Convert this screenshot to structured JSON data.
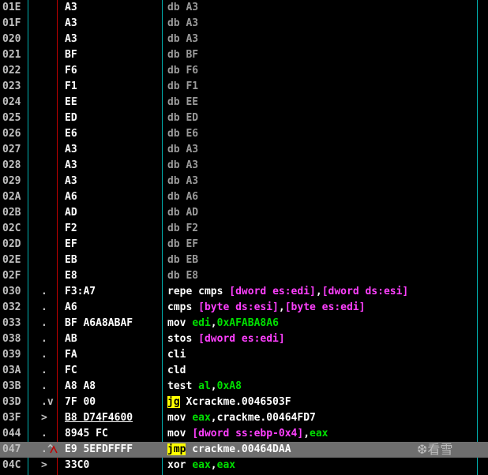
{
  "colors": {
    "background": "#000000",
    "address": "#c0c0c0",
    "hex": "#ffffff",
    "db_text": "#9a9a9a",
    "instruction": "#ffffff",
    "memory_operand": "#ff40ff",
    "register_and_immediate": "#00e000",
    "jump_highlight": "#ffff00",
    "selected_row": "#6e6e6e",
    "gutter_line": "#00b0b0",
    "separator_line": "#c00000"
  },
  "watermark": {
    "icon": "snowflake-icon",
    "glyph": "❆",
    "text": "看雪"
  },
  "rows": [
    {
      "addr": "01E",
      "flag": "",
      "hex": "A3",
      "dis": [
        {
          "t": "db A3",
          "c": "db"
        }
      ]
    },
    {
      "addr": "01F",
      "flag": "",
      "hex": "A3",
      "dis": [
        {
          "t": "db A3",
          "c": "db"
        }
      ]
    },
    {
      "addr": "020",
      "flag": "",
      "hex": "A3",
      "dis": [
        {
          "t": "db A3",
          "c": "db"
        }
      ]
    },
    {
      "addr": "021",
      "flag": "",
      "hex": "BF",
      "dis": [
        {
          "t": "db BF",
          "c": "db"
        }
      ]
    },
    {
      "addr": "022",
      "flag": "",
      "hex": "F6",
      "dis": [
        {
          "t": "db F6",
          "c": "db"
        }
      ]
    },
    {
      "addr": "023",
      "flag": "",
      "hex": "F1",
      "dis": [
        {
          "t": "db F1",
          "c": "db"
        }
      ]
    },
    {
      "addr": "024",
      "flag": "",
      "hex": "EE",
      "dis": [
        {
          "t": "db EE",
          "c": "db"
        }
      ]
    },
    {
      "addr": "025",
      "flag": "",
      "hex": "ED",
      "dis": [
        {
          "t": "db ED",
          "c": "db"
        }
      ]
    },
    {
      "addr": "026",
      "flag": "",
      "hex": "E6",
      "dis": [
        {
          "t": "db E6",
          "c": "db"
        }
      ]
    },
    {
      "addr": "027",
      "flag": "",
      "hex": "A3",
      "dis": [
        {
          "t": "db A3",
          "c": "db"
        }
      ]
    },
    {
      "addr": "028",
      "flag": "",
      "hex": "A3",
      "dis": [
        {
          "t": "db A3",
          "c": "db"
        }
      ]
    },
    {
      "addr": "029",
      "flag": "",
      "hex": "A3",
      "dis": [
        {
          "t": "db A3",
          "c": "db"
        }
      ]
    },
    {
      "addr": "02A",
      "flag": "",
      "hex": "A6",
      "dis": [
        {
          "t": "db A6",
          "c": "db"
        }
      ]
    },
    {
      "addr": "02B",
      "flag": "",
      "hex": "AD",
      "dis": [
        {
          "t": "db AD",
          "c": "db"
        }
      ]
    },
    {
      "addr": "02C",
      "flag": "",
      "hex": "F2",
      "dis": [
        {
          "t": "db F2",
          "c": "db"
        }
      ]
    },
    {
      "addr": "02D",
      "flag": "",
      "hex": "EF",
      "dis": [
        {
          "t": "db EF",
          "c": "db"
        }
      ]
    },
    {
      "addr": "02E",
      "flag": "",
      "hex": "EB",
      "dis": [
        {
          "t": "db EB",
          "c": "db"
        }
      ]
    },
    {
      "addr": "02F",
      "flag": "",
      "hex": "E8",
      "dis": [
        {
          "t": "db E8",
          "c": "db"
        }
      ]
    },
    {
      "addr": "030",
      "flag": ".",
      "hex": "F3:A7",
      "dis": [
        {
          "t": "repe cmps ",
          "c": "ins"
        },
        {
          "t": "[dword es:edi]",
          "c": "mem"
        },
        {
          "t": ",",
          "c": "sep"
        },
        {
          "t": "[dword ds:esi]",
          "c": "mem"
        }
      ]
    },
    {
      "addr": "032",
      "flag": ".",
      "hex": "A6",
      "dis": [
        {
          "t": "cmps ",
          "c": "ins"
        },
        {
          "t": "[byte ds:esi]",
          "c": "mem"
        },
        {
          "t": ",",
          "c": "sep"
        },
        {
          "t": "[byte es:edi]",
          "c": "mem"
        }
      ]
    },
    {
      "addr": "033",
      "flag": ".",
      "hex": "BF A6A8ABAF",
      "dis": [
        {
          "t": "mov ",
          "c": "ins"
        },
        {
          "t": "edi",
          "c": "reg"
        },
        {
          "t": ",",
          "c": "sep"
        },
        {
          "t": "0xAFABA8A6",
          "c": "num"
        }
      ]
    },
    {
      "addr": "038",
      "flag": ".",
      "hex": "AB",
      "dis": [
        {
          "t": "stos ",
          "c": "ins"
        },
        {
          "t": "[dword es:edi]",
          "c": "mem"
        }
      ]
    },
    {
      "addr": "039",
      "flag": ".",
      "hex": "FA",
      "dis": [
        {
          "t": "cli",
          "c": "ins"
        }
      ]
    },
    {
      "addr": "03A",
      "flag": ".",
      "hex": "FC",
      "dis": [
        {
          "t": "cld",
          "c": "ins"
        }
      ]
    },
    {
      "addr": "03B",
      "flag": ".",
      "hex": "A8 A8",
      "dis": [
        {
          "t": "test ",
          "c": "ins"
        },
        {
          "t": "al",
          "c": "reg"
        },
        {
          "t": ",",
          "c": "sep"
        },
        {
          "t": "0xA8",
          "c": "num"
        }
      ]
    },
    {
      "addr": "03D",
      "flag": ".v",
      "hex": "7F 00",
      "dis": [
        {
          "t": "jg",
          "c": "jmp"
        },
        {
          "t": " Xcrackme.0046503F",
          "c": "tgt"
        }
      ]
    },
    {
      "addr": "03F",
      "flag": ">",
      "hex": "B8 D74F4600",
      "hexU": true,
      "dis": [
        {
          "t": "mov ",
          "c": "ins"
        },
        {
          "t": "eax",
          "c": "reg"
        },
        {
          "t": ",",
          "c": "sep"
        },
        {
          "t": "crackme.00464FD7",
          "c": "sym"
        }
      ]
    },
    {
      "addr": "044",
      "flag": ".",
      "hex": "8945 FC",
      "dis": [
        {
          "t": "mov ",
          "c": "ins"
        },
        {
          "t": "[dword ss:ebp-0x4]",
          "c": "mem"
        },
        {
          "t": ",",
          "c": "sep"
        },
        {
          "t": "eax",
          "c": "reg"
        }
      ]
    },
    {
      "addr": "047",
      "flag": ".^",
      "hex": "E9 5EFDFFFF",
      "sel": true,
      "dis": [
        {
          "t": "jmp",
          "c": "jmp"
        },
        {
          "t": " crackme.00464DAA",
          "c": "tgt"
        }
      ]
    },
    {
      "addr": "04C",
      "flag": ">",
      "hex": "33C0",
      "dis": [
        {
          "t": "xor ",
          "c": "ins"
        },
        {
          "t": "eax",
          "c": "reg"
        },
        {
          "t": ",",
          "c": "sep"
        },
        {
          "t": "eax",
          "c": "reg"
        }
      ]
    }
  ]
}
